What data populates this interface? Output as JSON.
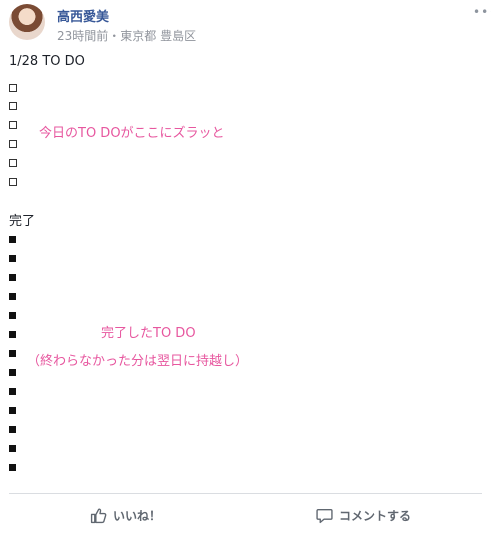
{
  "author": {
    "name": "高西愛美",
    "meta": "23時間前・東京都 豊島区"
  },
  "more_icon": "•••",
  "post": {
    "title": "1/28 TO DO",
    "todo_note": "今日のTO DOがここにズラッと",
    "completed_header": "完了",
    "completed_note_line1": "完了したTO DO",
    "completed_note_line2": "（終わらなかった分は翌日に持越し）"
  },
  "actions": {
    "like": "いいね！",
    "comment": "コメントする"
  },
  "colors": {
    "name": "#385898",
    "annotation": "#e7579f",
    "meta": "#90949c"
  }
}
